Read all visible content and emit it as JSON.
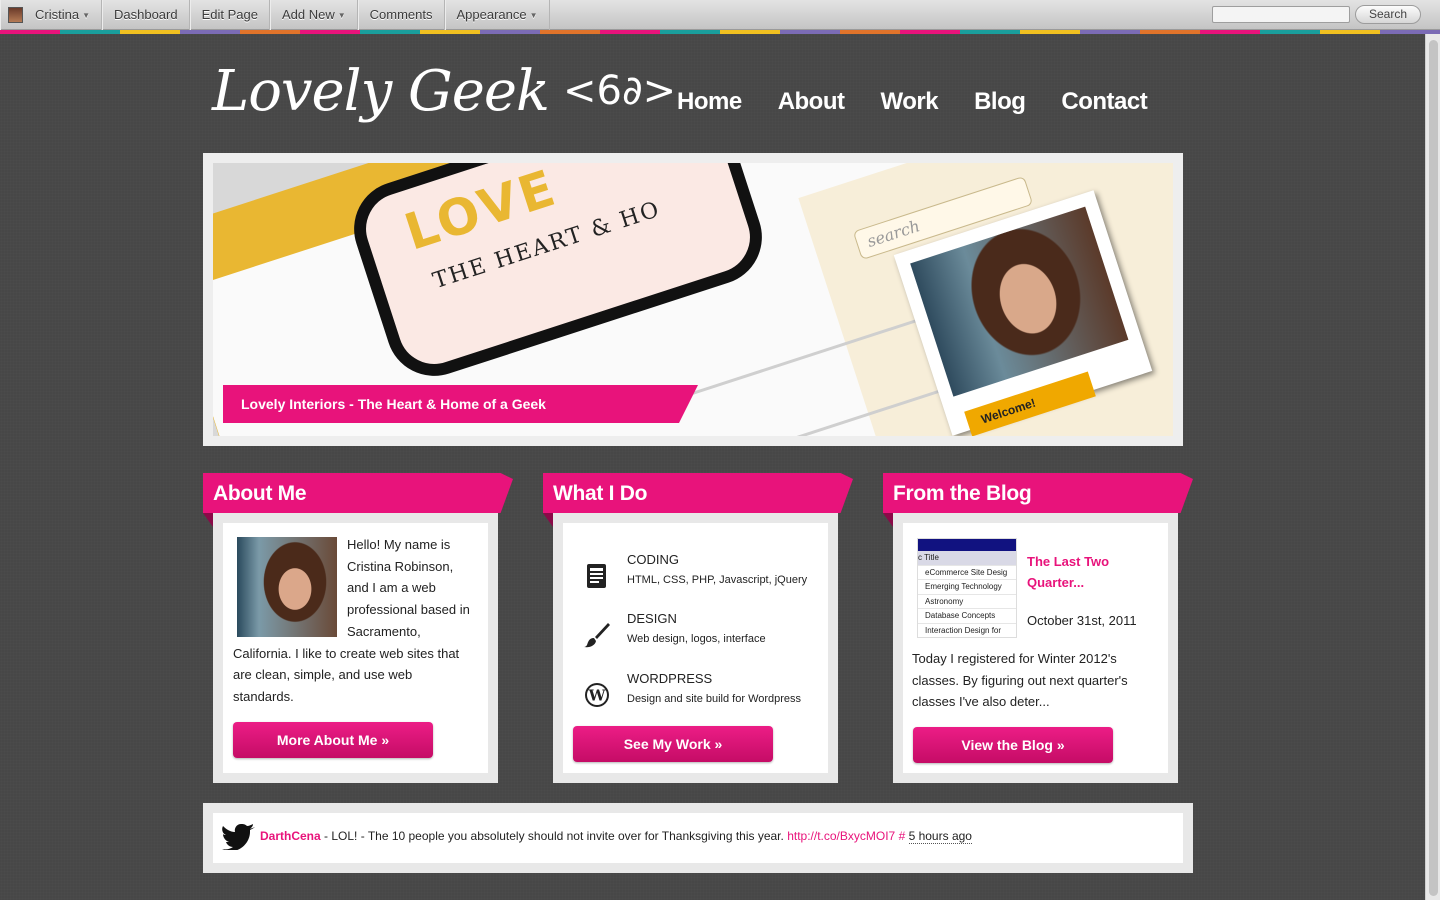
{
  "adminbar": {
    "user": "Cristina",
    "items": [
      "Dashboard",
      "Edit Page",
      "Add New",
      "Comments",
      "Appearance"
    ],
    "search_placeholder": "",
    "search_button": "Search"
  },
  "header": {
    "logo_script": "Lovely Geek",
    "logo_code": "<6∂>",
    "nav": [
      "Home",
      "About",
      "Work",
      "Blog",
      "Contact"
    ]
  },
  "slider": {
    "caption": "Lovely Interiors - The Heart & Home of a Geek",
    "slide_heading": "LOVE",
    "slide_subheading": "THE HEART & HO",
    "slide_search": "search",
    "slide_welcome": "Welcome!"
  },
  "about": {
    "heading": "About Me",
    "text": "Hello! My name is Cristina Robinson, and I am a web professional based in Sacramento, California. I like to create web sites that are clean, simple, and use web standards.",
    "button": "More About Me »"
  },
  "work": {
    "heading": "What I Do",
    "skills": [
      {
        "title": "CODING",
        "desc": "HTML, CSS, PHP, Javascript, jQuery",
        "icon": "document-icon"
      },
      {
        "title": "DESIGN",
        "desc": "Web design, logos, interface",
        "icon": "brush-icon"
      },
      {
        "title": "WORDPRESS",
        "desc": "Design and site build for Wordpress",
        "icon": "wordpress-icon"
      }
    ],
    "button": "See My Work »"
  },
  "blog": {
    "heading": "From the Blog",
    "thumb_rows": [
      "Title",
      "eCommerce Site Desig",
      "Emerging Technology",
      "Astronomy",
      "Database Concepts",
      "Interaction Design for"
    ],
    "title": "The Last Two Quarter...",
    "date": "October 31st, 2011",
    "excerpt": "Today I registered for Winter 2012's classes. By figuring out next quarter's classes I've also deter...",
    "button": "View the Blog »"
  },
  "tweet": {
    "user": "DarthCena",
    "text": " - LOL! - The 10 people you absolutely should not invite over for Thanksgiving this year. ",
    "link": "http://t.co/BxycMOI7",
    "hash": " # ",
    "ago": "5 hours ago"
  },
  "colors": {
    "accent": "#e8137b",
    "background": "#474747"
  }
}
